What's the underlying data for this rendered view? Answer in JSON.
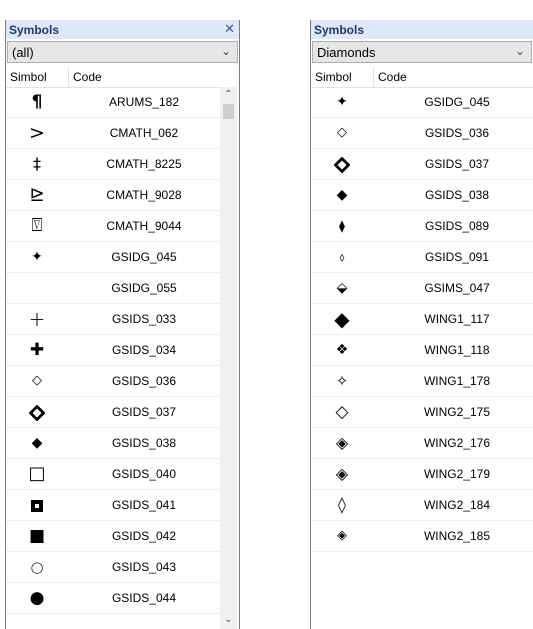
{
  "left_panel": {
    "title": "Symbols",
    "close": "✕",
    "category": "(all)",
    "columns": {
      "symbol": "Simbol",
      "code": "Code"
    },
    "rows": [
      {
        "symbol": "¶",
        "code": "ARUMS_182"
      },
      {
        "symbol": ">",
        "code": "CMATH_062"
      },
      {
        "symbol": "‡",
        "code": "CMATH_8225"
      },
      {
        "symbol": "⊵",
        "code": "CMATH_9028"
      },
      {
        "symbol": "⍔",
        "code": "CMATH_9044"
      },
      {
        "symbol": "✦",
        "code": "GSIDG_045"
      },
      {
        "symbol": "",
        "code": "GSIDG_055"
      },
      {
        "symbol": "+",
        "code": "GSIDS_033"
      },
      {
        "symbol": "✚",
        "code": "GSIDS_034"
      },
      {
        "symbol": "◇",
        "code": "GSIDS_036"
      },
      {
        "symbol": "◆",
        "code": "GSIDS_037"
      },
      {
        "symbol": "◆",
        "code": "GSIDS_038"
      },
      {
        "symbol": "□",
        "code": "GSIDS_040"
      },
      {
        "symbol": "▣",
        "code": "GSIDS_041"
      },
      {
        "symbol": "■",
        "code": "GSIDS_042"
      },
      {
        "symbol": "○",
        "code": "GSIDS_043"
      },
      {
        "symbol": "●",
        "code": "GSIDS_044"
      }
    ],
    "scroll_up": "⌃",
    "scroll_down": "⌄"
  },
  "right_panel": {
    "title": "Symbols",
    "close": "✕",
    "category": "Diamonds",
    "columns": {
      "symbol": "Simbol",
      "code": "Code"
    },
    "rows": [
      {
        "symbol": "✦",
        "code": "GSIDG_045"
      },
      {
        "symbol": "◇",
        "code": "GSIDS_036"
      },
      {
        "symbol": "◆",
        "code": "GSIDS_037"
      },
      {
        "symbol": "◆",
        "code": "GSIDS_038"
      },
      {
        "symbol": "⧫",
        "code": "GSIDS_089"
      },
      {
        "symbol": "⬨",
        "code": "GSIDS_091"
      },
      {
        "symbol": "⬙",
        "code": "GSIMS_047"
      },
      {
        "symbol": "◆",
        "code": "WING1_117"
      },
      {
        "symbol": "❖",
        "code": "WING1_118"
      },
      {
        "symbol": "✧",
        "code": "WING1_178"
      },
      {
        "symbol": "◇",
        "code": "WING2_175"
      },
      {
        "symbol": "◈",
        "code": "WING2_176"
      },
      {
        "symbol": "◈",
        "code": "WING2_179"
      },
      {
        "symbol": "◊",
        "code": "WING2_184"
      },
      {
        "symbol": "◈",
        "code": "WING2_185"
      }
    ]
  }
}
